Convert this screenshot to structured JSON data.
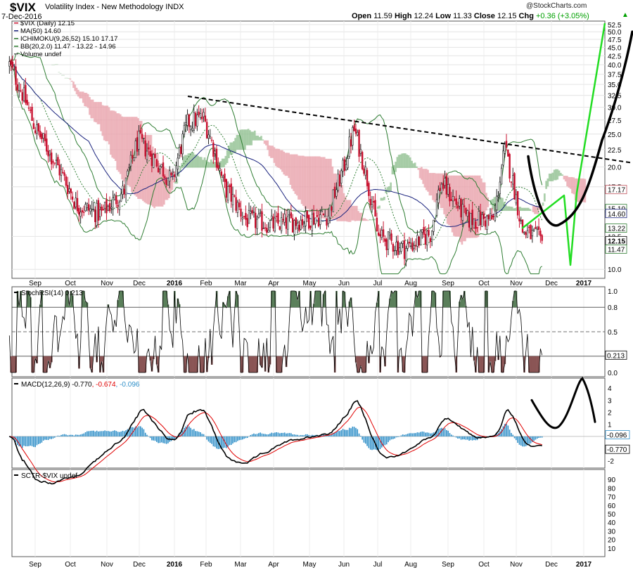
{
  "header": {
    "symbol": "$VIX",
    "description": "Volatility Index - New Methodology  INDX",
    "date": "7-Dec-2016",
    "copyright": "@StockCharts.com",
    "open_label": "Open",
    "open": "11.59",
    "high_label": "High",
    "high": "12.24",
    "low_label": "Low",
    "low": "11.33",
    "close_label": "Close",
    "close": "12.15",
    "chg_label": "Chg",
    "chg": "+0.36 (+3.05%)",
    "up_arrow": "▲"
  },
  "colors": {
    "price_up": "#222222",
    "price_down": "#c8102e",
    "ma": "#1a237e",
    "bollinger": "#2e7d32",
    "cloud_bear": "#e8a0aa",
    "cloud_bull": "#8fbf8f",
    "macd": "#000000",
    "signal": "#e00000",
    "histogram": "#2f8fc8",
    "stoch": "#000000",
    "drawing_black": "#000000",
    "drawing_green": "#22dd22"
  },
  "chart_data": [
    {
      "type": "candlestick",
      "panel": "price",
      "legend": [
        "$VIX (Daily) 12.15",
        "MA(50) 14.60",
        "ICHIMOKU(9,26,52) 15.10 17.17",
        "BB(20,2.0) 11.47 - 13.22 - 14.96",
        "Volume undef"
      ],
      "x_tick_labels": [
        "Sep",
        "Oct",
        "Nov",
        "Dec",
        "2016",
        "Feb",
        "Mar",
        "Apr",
        "May",
        "Jun",
        "Jul",
        "Aug",
        "Sep",
        "Oct",
        "Nov",
        "Dec",
        "2017"
      ],
      "y_tick_labels": [
        "10.0",
        "12.5",
        "15.0",
        "17.5",
        "20.0",
        "22.5",
        "25.0",
        "27.5",
        "30.0",
        "32.5",
        "35.0",
        "37.5",
        "40.0",
        "42.5",
        "45.0",
        "47.5",
        "50.0",
        "52.5"
      ],
      "y_scale": "log",
      "y_range": [
        9.5,
        53
      ],
      "value_tags": [
        "17.17",
        "15.10",
        "14.60",
        "13.22",
        "12.15",
        "11.47"
      ],
      "close_approx": {
        "dates": [
          "2015-08-24",
          "2015-09-15",
          "2015-10-01",
          "2015-10-20",
          "2015-11-10",
          "2015-12-01",
          "2015-12-14",
          "2015-12-31",
          "2016-01-20",
          "2016-02-11",
          "2016-03-01",
          "2016-03-20",
          "2016-04-15",
          "2016-05-10",
          "2016-06-01",
          "2016-06-15",
          "2016-06-24",
          "2016-07-15",
          "2016-08-10",
          "2016-09-01",
          "2016-09-09",
          "2016-10-01",
          "2016-10-25",
          "2016-11-04",
          "2016-11-20",
          "2016-12-07"
        ],
        "values": [
          40.0,
          26.0,
          21.0,
          15.5,
          14.5,
          17.0,
          24.0,
          18.0,
          27.0,
          28.0,
          17.5,
          14.0,
          13.5,
          14.0,
          14.5,
          20.0,
          25.8,
          12.5,
          11.5,
          12.8,
          18.0,
          14.0,
          14.0,
          22.5,
          13.0,
          12.15
        ]
      },
      "annotations": [
        "dashed resistance trendline from the Jan 2016 high to Dec 2016",
        "hand-drawn green line projecting up toward 52.5 into 2017",
        "hand-drawn black curve rising toward 50 into 2017"
      ]
    },
    {
      "type": "line",
      "panel": "stochrsi",
      "legend": [
        "StochRSI(14) 0.213"
      ],
      "y_tick_labels": [
        "0.0",
        "0.2",
        "0.5",
        "0.8",
        "1.0"
      ],
      "y_range": [
        0,
        1
      ],
      "reference_lines": [
        0.2,
        0.5,
        0.8
      ],
      "value_tags": [
        "0.213"
      ],
      "last_value": 0.213
    },
    {
      "type": "line",
      "panel": "macd",
      "legend": [
        "MACD(12,26,9)",
        "-0.770",
        "-0.674",
        "-0.096"
      ],
      "y_tick_labels": [
        "-2",
        "-1",
        "1",
        "2",
        "3",
        "4"
      ],
      "y_range": [
        -2.5,
        4.7
      ],
      "series": [
        {
          "name": "MACD",
          "last": -0.77
        },
        {
          "name": "signal",
          "last": -0.674
        },
        {
          "name": "histogram",
          "last": -0.096
        }
      ],
      "value_tags": [
        "-0.096",
        "-0.770"
      ],
      "annotations": [
        "hand-drawn black curve sketching MACD rising to about 4.5 then falling to about 1.5"
      ]
    },
    {
      "type": "line",
      "panel": "sctr",
      "legend": [
        "SCTR-$VIX undef"
      ],
      "y_tick_labels": [
        "10",
        "20",
        "30",
        "40",
        "50",
        "60",
        "70",
        "80",
        "90"
      ],
      "y_range": [
        0,
        100
      ]
    }
  ]
}
